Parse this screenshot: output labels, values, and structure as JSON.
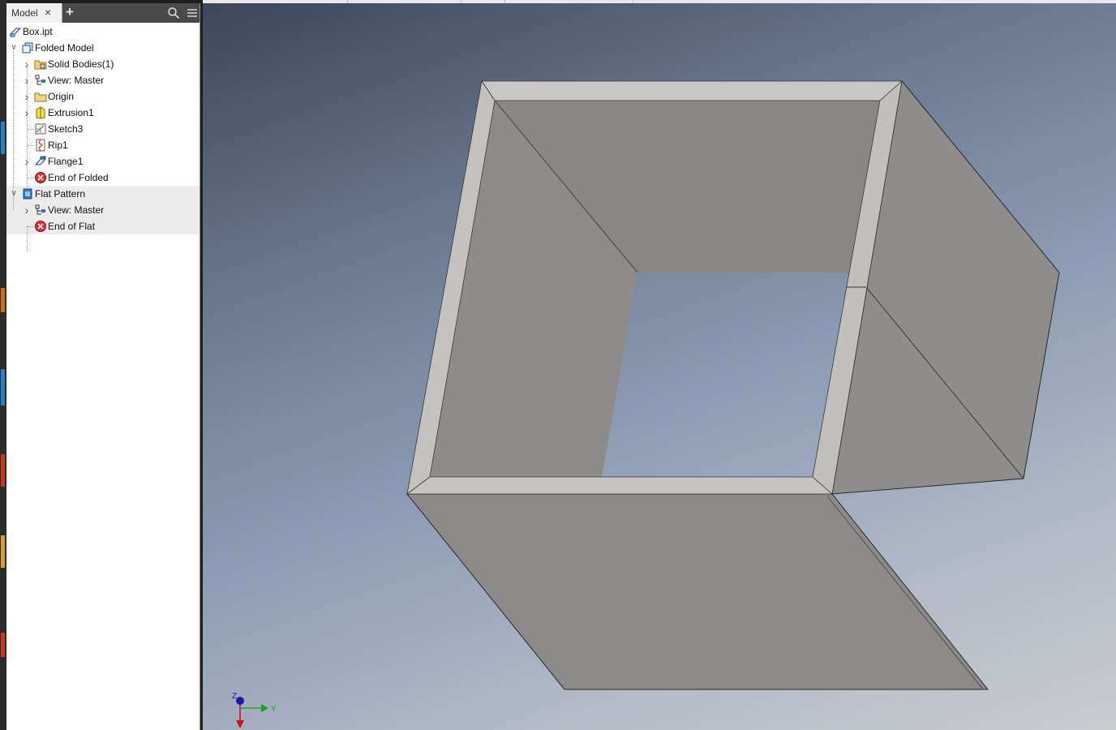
{
  "browser": {
    "tab_label": "Model",
    "close_glyph": "×",
    "add_glyph": "+",
    "icons": {
      "search": "search-icon",
      "menu": "menu-icon"
    },
    "tree": [
      {
        "label": "Box.ipt",
        "icon": "part-icon",
        "level": 0,
        "expander": "none"
      },
      {
        "label": "Folded Model",
        "icon": "folded-model-icon",
        "level": 1,
        "expander": "expanded"
      },
      {
        "label": "Solid Bodies(1)",
        "icon": "solid-bodies-folder-icon",
        "level": 2,
        "expander": "collapsed"
      },
      {
        "label": "View: Master",
        "icon": "view-rep-icon",
        "level": 2,
        "expander": "collapsed"
      },
      {
        "label": "Origin",
        "icon": "folder-icon",
        "level": 2,
        "expander": "collapsed"
      },
      {
        "label": "Extrusion1",
        "icon": "extrusion-icon",
        "level": 2,
        "expander": "collapsed"
      },
      {
        "label": "Sketch3",
        "icon": "sketch-icon",
        "level": 2,
        "expander": "none"
      },
      {
        "label": "Rip1",
        "icon": "rip-icon",
        "level": 2,
        "expander": "none"
      },
      {
        "label": "Flange1",
        "icon": "flange-icon",
        "level": 2,
        "expander": "collapsed"
      },
      {
        "label": "End of Folded",
        "icon": "end-of-part-icon",
        "level": 2,
        "expander": "none"
      },
      {
        "label": "Flat Pattern",
        "icon": "flat-pattern-icon",
        "level": 1,
        "expander": "expanded"
      },
      {
        "label": "View: Master",
        "icon": "view-rep-icon",
        "level": 2,
        "expander": "collapsed"
      },
      {
        "label": "End of Flat",
        "icon": "end-of-part-icon",
        "level": 2,
        "expander": "none"
      }
    ]
  },
  "viewport": {
    "axis_labels": {
      "z": "Z",
      "y": "Y"
    },
    "colors": {
      "axis_x": "#cc1111",
      "axis_y": "#22a022",
      "axis_z": "#1a1aa8"
    }
  }
}
